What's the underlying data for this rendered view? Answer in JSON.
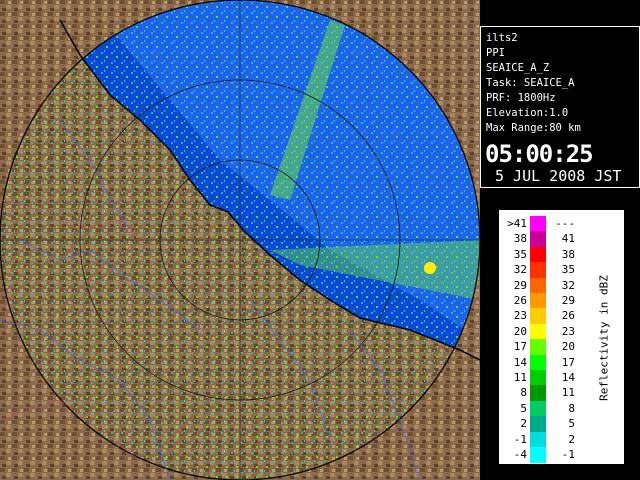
{
  "info": {
    "lines": [
      "ilts2",
      "PPI",
      "SEAICE_A_Z",
      "Task: SEAICE_A",
      "PRF: 1800Hz",
      "Elevation:1.0",
      "Max Range:80 km"
    ],
    "time": "05:00:25",
    "date": "5 JUL 2008 JST"
  },
  "legend": {
    "title": "Reflectivity in dBZ",
    "left_labels": [
      ">41",
      "38",
      "35",
      "32",
      "29",
      "26",
      "23",
      "20",
      "17",
      "14",
      "11",
      "8",
      "5",
      "2",
      "-1",
      "-4"
    ],
    "right_labels": [
      "---",
      "41",
      "38",
      "35",
      "32",
      "29",
      "26",
      "23",
      "20",
      "17",
      "14",
      "11",
      "8",
      "5",
      "2",
      "-1"
    ],
    "colors": [
      "#ff00ff",
      "#c80096",
      "#ff0000",
      "#ff3200",
      "#ff6600",
      "#ff9900",
      "#ffcc00",
      "#ffff00",
      "#66ff00",
      "#00ff00",
      "#00cc00",
      "#009900",
      "#00cc66",
      "#00aa88",
      "#00dddd",
      "#00ffff"
    ]
  }
}
